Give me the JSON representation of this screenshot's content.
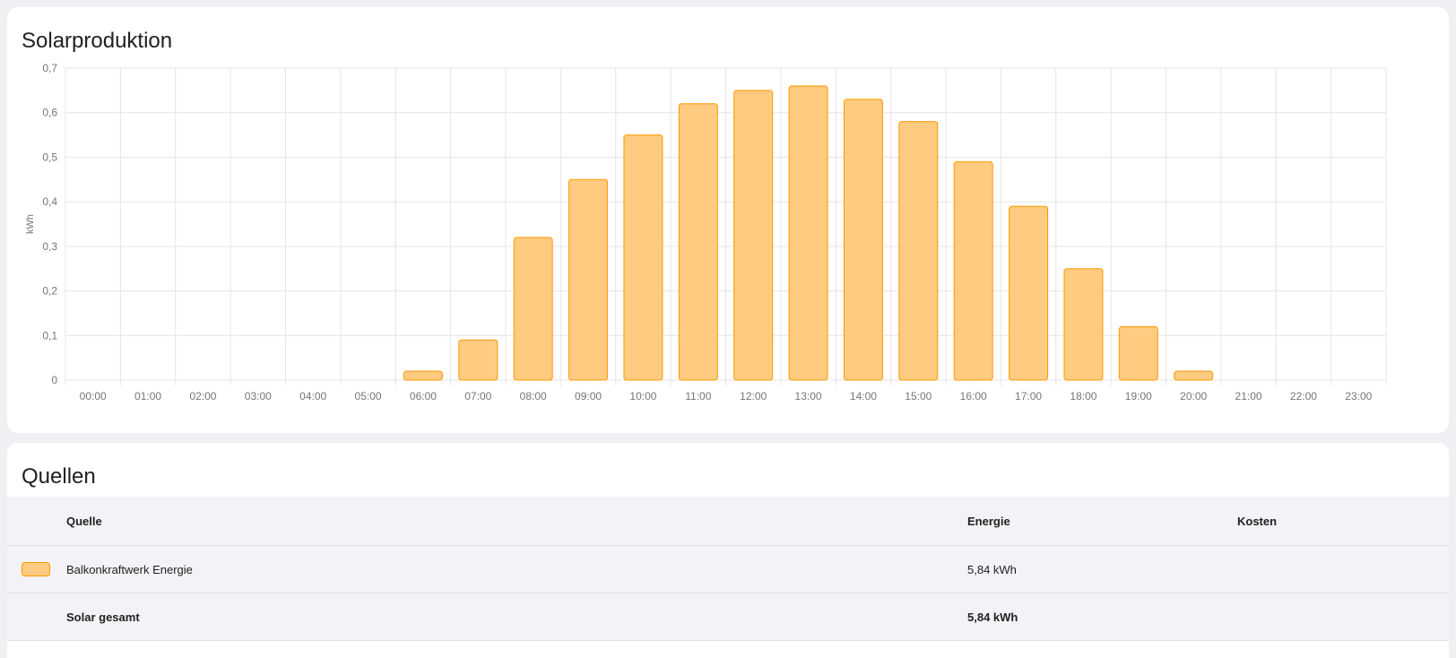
{
  "chart_card": {
    "title": "Solarproduktion"
  },
  "chart_data": {
    "type": "bar",
    "ylabel": "kWh",
    "xlabel": "",
    "ylim": [
      0,
      0.7
    ],
    "yticks": [
      "0",
      "0,1",
      "0,2",
      "0,3",
      "0,4",
      "0,5",
      "0,6",
      "0,7"
    ],
    "grid": true,
    "categories": [
      "00:00",
      "01:00",
      "02:00",
      "03:00",
      "04:00",
      "05:00",
      "06:00",
      "07:00",
      "08:00",
      "09:00",
      "10:00",
      "11:00",
      "12:00",
      "13:00",
      "14:00",
      "15:00",
      "16:00",
      "17:00",
      "18:00",
      "19:00",
      "20:00",
      "21:00",
      "22:00",
      "23:00"
    ],
    "values": [
      0,
      0,
      0,
      0,
      0,
      0,
      0.02,
      0.09,
      0.32,
      0.45,
      0.55,
      0.62,
      0.65,
      0.66,
      0.63,
      0.58,
      0.49,
      0.39,
      0.25,
      0.12,
      0.02,
      0,
      0,
      0
    ],
    "color_fill": "#ffcb80",
    "color_stroke": "#ff9800"
  },
  "sources_card": {
    "title": "Quellen",
    "columns": {
      "source": "Quelle",
      "energy": "Energie",
      "cost": "Kosten"
    },
    "rows": [
      {
        "name": "Balkonkraftwerk Energie",
        "energy": "5,84 kWh",
        "cost": "",
        "swatch_color": "#ffcb80"
      }
    ],
    "total": {
      "name": "Solar gesamt",
      "energy": "5,84 kWh",
      "cost": ""
    }
  }
}
